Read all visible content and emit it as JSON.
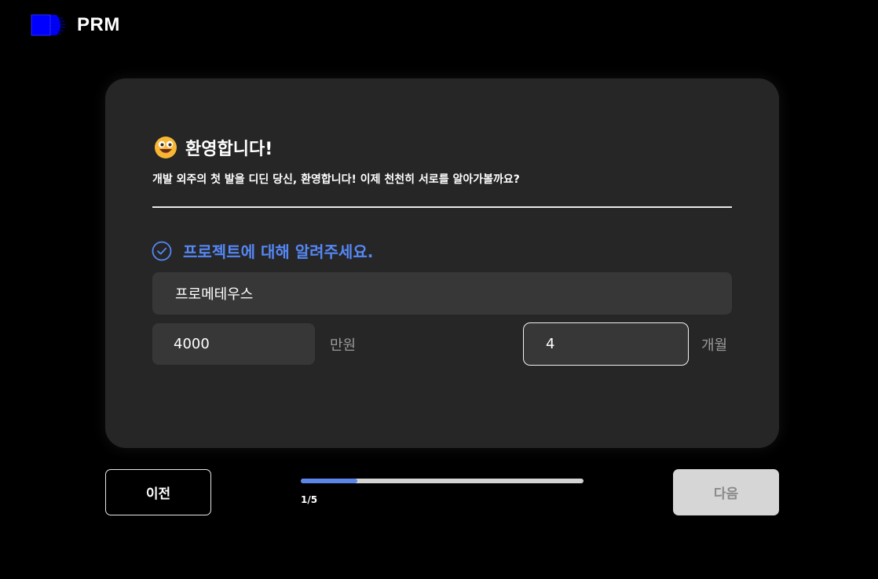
{
  "header": {
    "logo_icon": "prm-logo-icon",
    "brand": "PRM"
  },
  "card": {
    "welcome_icon": "grinning-face-emoji-icon",
    "title": "환영합니다!",
    "subtitle": "개발 외주의 첫 발을 디딘 당신, 환영합니다! 이제 천천히 서로를 알아가볼까요?",
    "section_icon": "check-circle-icon",
    "section_title": "프로젝트에 대해 알려주세요.",
    "project_name": {
      "value": "프로메테우스"
    },
    "budget": {
      "value": "4000",
      "unit": "만원"
    },
    "period": {
      "value": "4",
      "unit": "개월"
    }
  },
  "footer": {
    "prev_label": "이전",
    "next_label": "다음",
    "progress_label": "1/5",
    "progress_fraction": 0.2
  },
  "colors": {
    "accent": "#5587f5",
    "card_bg": "#262626",
    "input_bg": "#373737",
    "logo_blue": "#0000ff",
    "next_disabled_bg": "#d6d6d6"
  }
}
